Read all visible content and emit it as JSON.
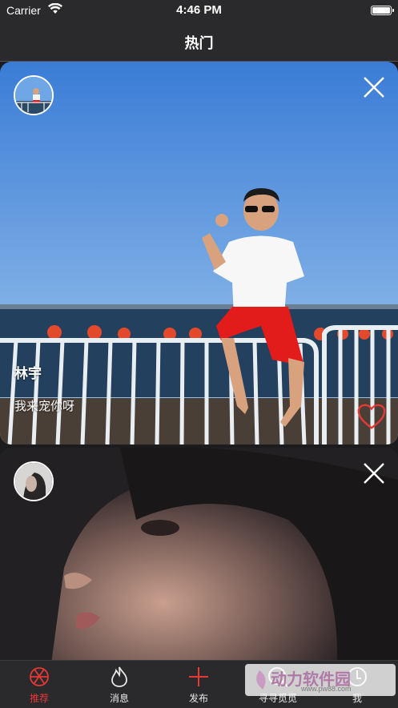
{
  "status_bar": {
    "carrier": "Carrier",
    "time": "4:46 PM"
  },
  "nav": {
    "title": "热门"
  },
  "posts": [
    {
      "username": "林宇",
      "caption": "我来宠你呀"
    },
    {
      "username": "",
      "caption": ""
    }
  ],
  "tabs": [
    {
      "label": "推荐",
      "icon": "aperture-icon",
      "active": true
    },
    {
      "label": "消息",
      "icon": "flame-icon"
    },
    {
      "label": "发布",
      "icon": "plus-icon"
    },
    {
      "label": "寻寻觅觅",
      "icon": "search-icon"
    },
    {
      "label": "我",
      "icon": "profile-icon"
    }
  ],
  "watermark": {
    "text": "动力软件园",
    "url": "www.pw88.com"
  },
  "colors": {
    "accent": "#e53935",
    "bar_bg": "#2a2a2c"
  }
}
